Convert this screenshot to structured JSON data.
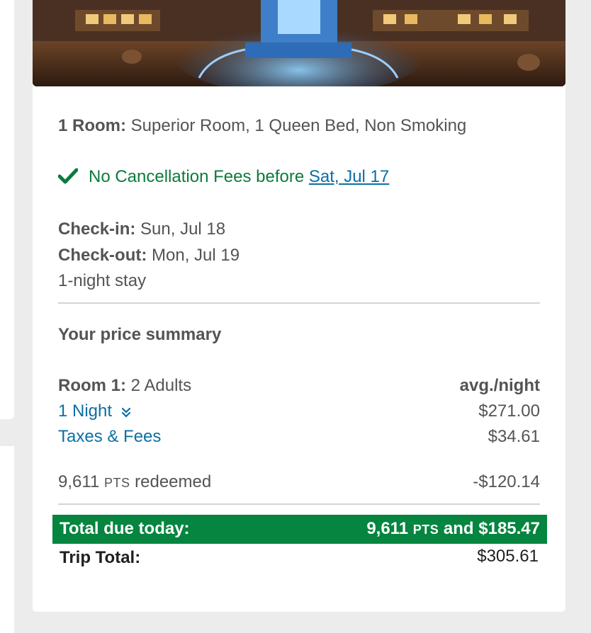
{
  "room": {
    "label": "1 Room:",
    "value": "Superior Room, 1 Queen Bed, Non Smoking"
  },
  "cancellation": {
    "text": "No Cancellation Fees before",
    "date_link": "Sat, Jul 17"
  },
  "stay": {
    "checkin_label": "Check-in:",
    "checkin_value": "Sun, Jul 18",
    "checkout_label": "Check-out:",
    "checkout_value": "Mon, Jul 19",
    "length": "1-night stay"
  },
  "summary": {
    "heading": "Your price summary",
    "room_label": "Room 1:",
    "room_guests": "2 Adults",
    "avg_label": "avg./night",
    "nights_link": "1 Night",
    "nights_price": "$271.00",
    "taxes_link": "Taxes & Fees",
    "taxes_price": "$34.61",
    "points_amount": "9,611",
    "points_unit": "PTS",
    "points_suffix": "redeemed",
    "points_discount": "-$120.14",
    "total_due_label": "Total due today:",
    "total_due_points": "9,611",
    "total_due_unit": "PTS",
    "total_due_cash": "and $185.47",
    "trip_total_label": "Trip Total:",
    "trip_total_value": "$305.61"
  },
  "colors": {
    "green": "#0b7b3e",
    "green_bar": "#05853f",
    "link_blue": "#0b6fa4",
    "text_gray": "#545454"
  },
  "icons": {
    "check": "check-icon",
    "expand": "chevron-double-down-icon"
  }
}
